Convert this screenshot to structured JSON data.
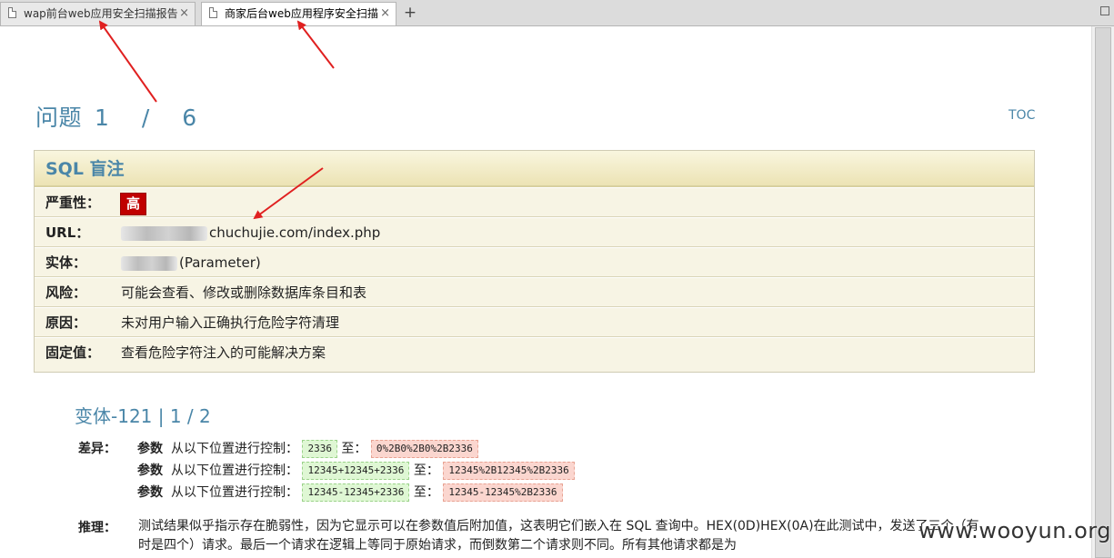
{
  "tabs": [
    {
      "title": "wap前台web应用安全扫描报告",
      "close": "×"
    },
    {
      "title": "商家后台web应用程序安全扫描",
      "close": "×"
    }
  ],
  "new_tab": "+",
  "header": {
    "title": "问题",
    "counter": "1 / 6",
    "toc": "TOC"
  },
  "issue": {
    "title": "SQL 盲注",
    "severity_label": "严重性：",
    "severity_value": "高",
    "url_label": "URL：",
    "url_value": "chuchujie.com/index.php",
    "entity_label": "实体：",
    "entity_value": "(Parameter)",
    "risk_label": "风险：",
    "risk_value": "可能会查看、修改或删除数据库条目和表",
    "cause_label": "原因：",
    "cause_value": "未对用户输入正确执行危险字符清理",
    "fix_label": "固定值：",
    "fix_value": "查看危险字符注入的可能解决方案"
  },
  "variant": {
    "title": "变体-121 | 1 / 2",
    "diff_label": "差异：",
    "diffs": [
      {
        "param": "参数",
        "desc": "从以下位置进行控制：",
        "from": "2336",
        "to_label": "至：",
        "to": "0%2B0%2B0%2B2336"
      },
      {
        "param": "参数",
        "desc": "从以下位置进行控制：",
        "from": "12345+12345+2336",
        "to_label": "至：",
        "to": "12345%2B12345%2B2336"
      },
      {
        "param": "参数",
        "desc": "从以下位置进行控制：",
        "from": "12345-12345+2336",
        "to_label": "至：",
        "to": "12345-12345%2B2336"
      }
    ],
    "reason_label": "推理：",
    "reason_text": "测试结果似乎指示存在脆弱性，因为它显示可以在参数值后附加值，这表明它们嵌入在 SQL 查询中。HEX(0D)HEX(0A)在此测试中，发送了三个（有时是四个）请求。最后一个请求在逻辑上等同于原始请求，而倒数第二个请求则不同。所有其他请求都是为"
  },
  "watermark": "www.wooyun.org",
  "colors": {
    "accent": "#4a86a8",
    "severity_high": "#c00000",
    "arrow": "#e02020"
  }
}
